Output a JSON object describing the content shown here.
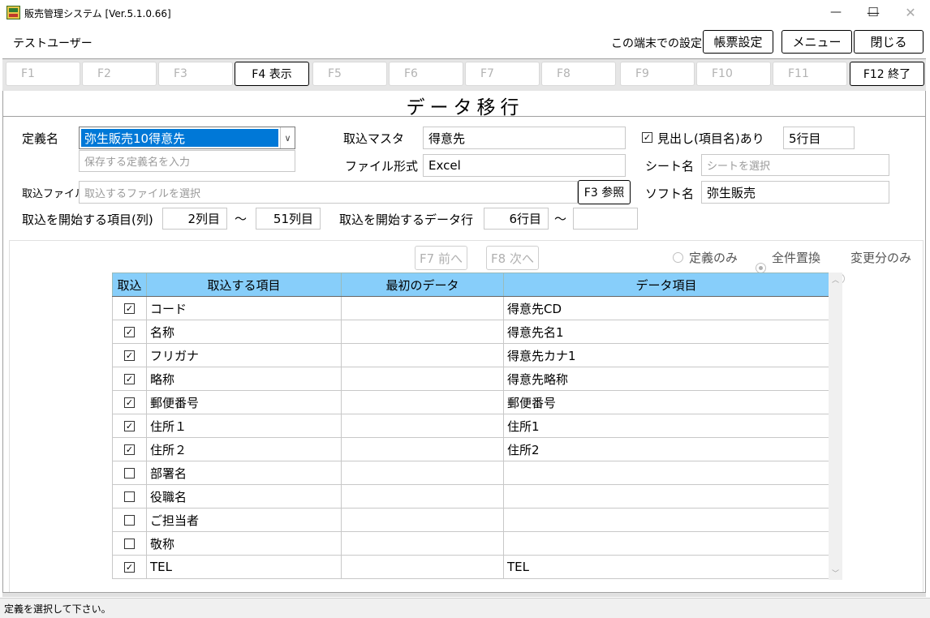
{
  "window": {
    "title": "販売管理システム [Ver.5.1.0.66]",
    "minimize": "—",
    "maximize": "☐",
    "close": "✕"
  },
  "header": {
    "user": "テストユーザー",
    "settings_label": "この端末での設定",
    "report_settings": "帳票設定",
    "menu": "メニュー",
    "close": "閉じる"
  },
  "fkeys": [
    {
      "label": "F1",
      "enabled": false
    },
    {
      "label": "F2",
      "enabled": false
    },
    {
      "label": "F3",
      "enabled": false
    },
    {
      "label": "F4 表示",
      "enabled": true
    },
    {
      "label": "F5",
      "enabled": false
    },
    {
      "label": "F6",
      "enabled": false
    },
    {
      "label": "F7",
      "enabled": false
    },
    {
      "label": "F8",
      "enabled": false
    },
    {
      "label": "F9",
      "enabled": false
    },
    {
      "label": "F10",
      "enabled": false
    },
    {
      "label": "F11",
      "enabled": false
    },
    {
      "label": "F12 終了",
      "enabled": true
    }
  ],
  "page_title": "データ移行",
  "form": {
    "definition_label": "定義名",
    "definition_value": "弥生販売10得意先",
    "definition_placeholder": "保存する定義名を入力",
    "master_label": "取込マスタ",
    "master_value": "得意先",
    "header_check_label": "見出し(項目名)あり",
    "header_checked": true,
    "header_rows": "5行目",
    "format_label": "ファイル形式",
    "format_value": "Excel",
    "sheet_label": "シート名",
    "sheet_placeholder": "シートを選択",
    "file_label": "取込ファイル",
    "file_placeholder": "取込するファイルを選択",
    "browse_button": "F3 参照",
    "soft_label": "ソフト名",
    "soft_value": "弥生販売",
    "start_col_label": "取込を開始する項目(列)",
    "start_col_value": "2列目",
    "tilde": "～",
    "end_col_value": "51列目",
    "start_row_label": "取込を開始するデータ行",
    "start_row_value": "6行目",
    "end_row_value": ""
  },
  "nav": {
    "prev": "F7 前へ",
    "next": "F8 次へ"
  },
  "modes": [
    {
      "label": "定義のみ",
      "selected": false
    },
    {
      "label": "全件置換",
      "selected": true
    },
    {
      "label": "変更分のみ",
      "selected": false
    }
  ],
  "table": {
    "headers": [
      "取込",
      "取込する項目",
      "最初のデータ",
      "データ項目"
    ],
    "rows": [
      {
        "checked": true,
        "item": "コード",
        "first": "",
        "data": "得意先CD"
      },
      {
        "checked": true,
        "item": "名称",
        "first": "",
        "data": "得意先名1"
      },
      {
        "checked": true,
        "item": "フリガナ",
        "first": "",
        "data": "得意先カナ1"
      },
      {
        "checked": true,
        "item": "略称",
        "first": "",
        "data": "得意先略称"
      },
      {
        "checked": true,
        "item": "郵便番号",
        "first": "",
        "data": "郵便番号"
      },
      {
        "checked": true,
        "item": "住所１",
        "first": "",
        "data": "住所1"
      },
      {
        "checked": true,
        "item": "住所２",
        "first": "",
        "data": "住所2"
      },
      {
        "checked": false,
        "item": "部署名",
        "first": "",
        "data": ""
      },
      {
        "checked": false,
        "item": "役職名",
        "first": "",
        "data": ""
      },
      {
        "checked": false,
        "item": "ご担当者",
        "first": "",
        "data": ""
      },
      {
        "checked": false,
        "item": "敬称",
        "first": "",
        "data": ""
      },
      {
        "checked": true,
        "item": "TEL",
        "first": "",
        "data": "TEL"
      }
    ]
  },
  "status": "定義を選択して下さい。"
}
